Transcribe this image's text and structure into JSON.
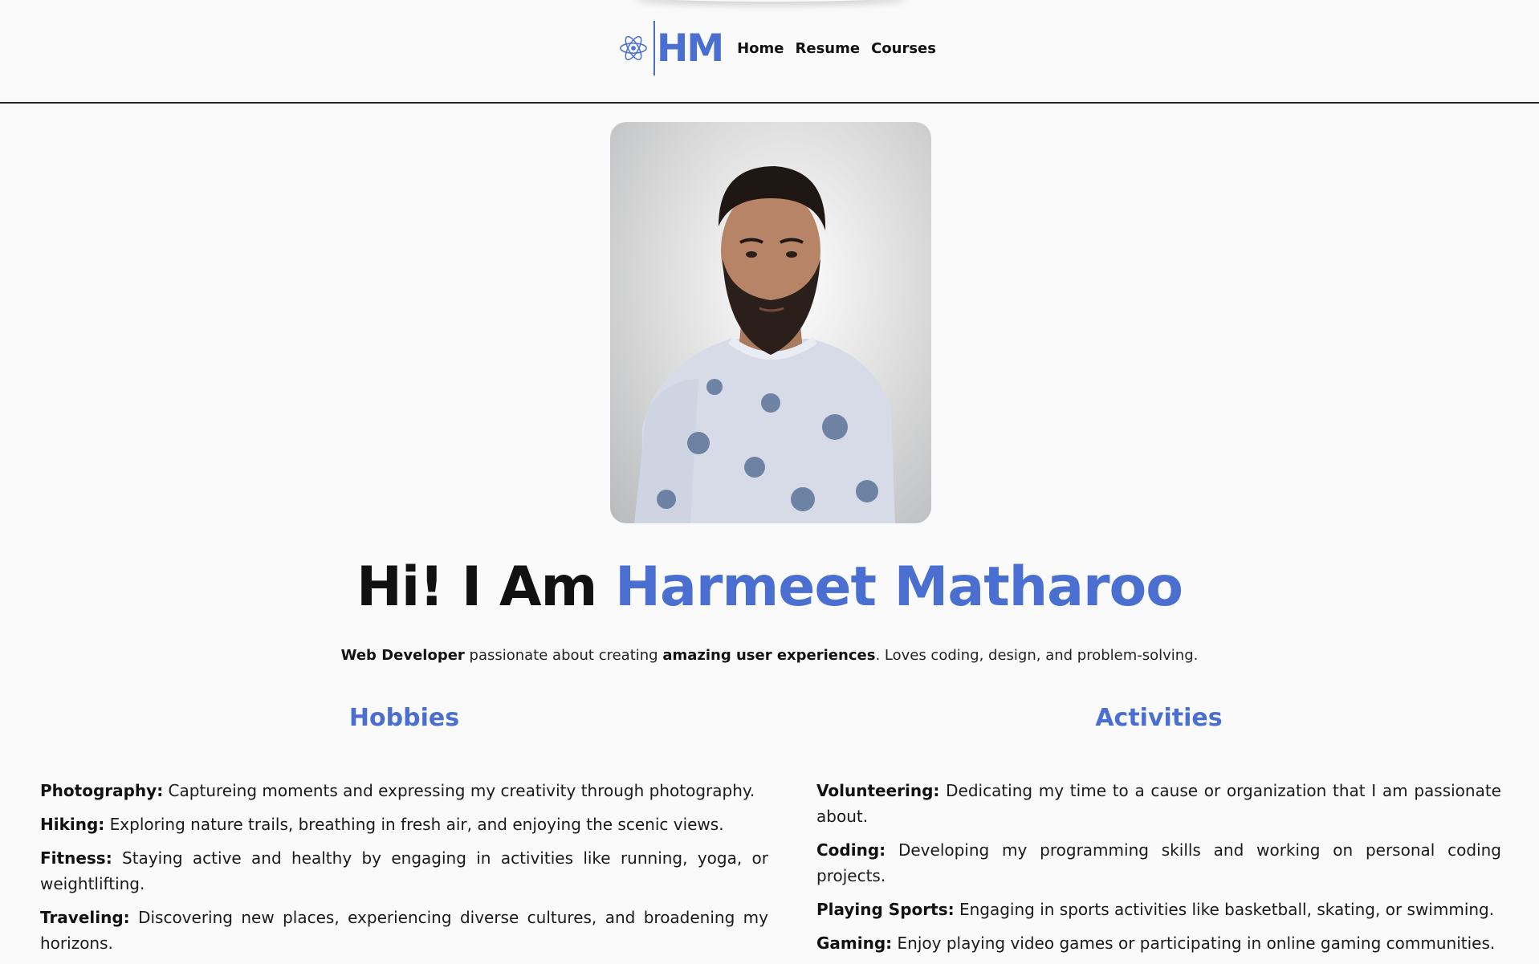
{
  "nav": {
    "logo_text": "HM",
    "logo_icon": "atom-icon",
    "links": [
      "Home",
      "Resume",
      "Courses"
    ]
  },
  "profile": {
    "photo_icon": "profile-photo",
    "greeting": "Hi! I Am ",
    "name": "Harmeet Matharoo",
    "tagline": {
      "role": "Web Developer",
      "mid": " passionate about creating ",
      "highlight": "amazing user experiences",
      "end": ". Loves coding, design, and problem-solving."
    }
  },
  "hobbies": {
    "heading": "Hobbies",
    "items": [
      {
        "title": "Photography:",
        "text": " Captureing moments and expressing my creativity through photography."
      },
      {
        "title": "Hiking:",
        "text": " Exploring nature trails, breathing in fresh air, and enjoying the scenic views."
      },
      {
        "title": "Fitness:",
        "text": " Staying active and healthy by engaging in activities like running, yoga, or weightlifting."
      },
      {
        "title": "Traveling:",
        "text": " Discovering new places, experiencing diverse cultures, and broadening my horizons."
      }
    ]
  },
  "activities": {
    "heading": "Activities",
    "items": [
      {
        "title": "Volunteering:",
        "text": " Dedicating my time to a cause or organization that I am passionate about."
      },
      {
        "title": "Coding:",
        "text": " Developing my programming skills and working on personal coding projects."
      },
      {
        "title": "Playing Sports:",
        "text": " Engaging in sports activities like basketball, skating, or swimming."
      },
      {
        "title": "Gaming:",
        "text": " Enjoy playing video games or participating in online gaming communities."
      }
    ]
  },
  "colors": {
    "accent": "#4a6fd1",
    "background": "#fafafa",
    "text": "#111111"
  }
}
